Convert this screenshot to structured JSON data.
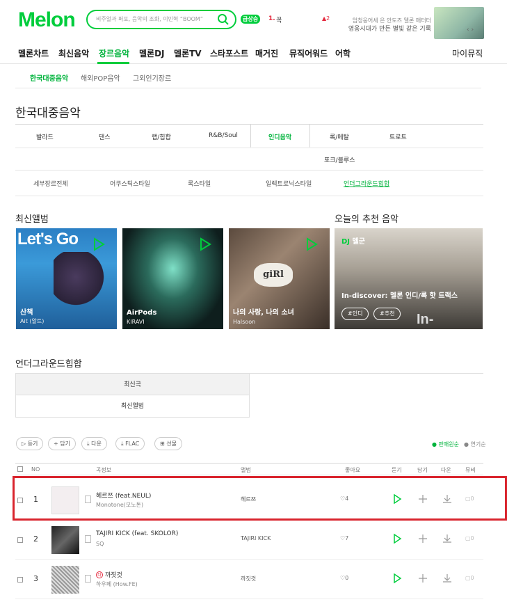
{
  "header": {
    "logo": "Melon",
    "search_placeholder": "비주얼과 퍼포, 음악의 조화, 이민혁 “BOOM”",
    "realtime_badge": "급상승",
    "realtime_rank": "1.",
    "realtime_title": "꼭",
    "realtime_change": "▲2",
    "promo_line1": "엄청웅어세 은 안도즈 멜론 매터터",
    "promo_line2": "영웅시대가 만든 별빛 같은 기록",
    "promo_nav": "‹ ›"
  },
  "nav": {
    "items": [
      "멜론차트",
      "최신음악",
      "장르음악",
      "멜론DJ",
      "멜론TV",
      "스타포스트",
      "매거진",
      "뮤직어워드",
      "어학"
    ],
    "my_music": "마이뮤직"
  },
  "subnav": {
    "items": [
      "한국대중음악",
      "해외POP음악",
      "그외인기장르"
    ]
  },
  "page_title": "한국대중음악",
  "genres": {
    "row1": [
      "발라드",
      "댄스",
      "랩/힙합",
      "R&B/Soul",
      "인디음악",
      "록/메탈",
      "트로트"
    ],
    "row2": [
      "포크/블루스"
    ],
    "sub": [
      "세부장르전체",
      "어쿠스틱스타일",
      "록스타일",
      "일렉트로닉스타일",
      "언더그라운드힙합"
    ]
  },
  "latest_albums": {
    "heading": "최신앨범",
    "items": [
      {
        "title": "산책",
        "artist": "Ait (알트)",
        "cover_text": "Let's Go"
      },
      {
        "title": "AirPods",
        "artist": "KIRAVI",
        "cover_text": ""
      },
      {
        "title": "나의 사랑, 나의 소녀",
        "artist": "Halsoon",
        "cover_text": "giRl"
      }
    ]
  },
  "recommend": {
    "heading": "오늘의 추천 음악",
    "dj_label": "DJ",
    "dj_name": "멜군",
    "title": "In-discover: 멜론 인디/록 핫 트랙스",
    "tags": [
      "#인디",
      "#추천"
    ],
    "cover_text": "In-discover"
  },
  "underground": {
    "heading": "언더그라운드힙합",
    "tabs": [
      "최신곡",
      "최신앨범"
    ]
  },
  "actions": {
    "buttons": [
      "▷ 듣기",
      "+ 담기",
      "⤓ 다운",
      "⤓ FLAC",
      "⊞ 선물"
    ],
    "sort_popular": "● 판매원순",
    "sort_recent": "● 연기순"
  },
  "table": {
    "headers": [
      "NO",
      "곡정보",
      "앨범",
      "좋아요",
      "듣기",
      "담기",
      "다운",
      "뮤비"
    ],
    "rows": [
      {
        "no": "1",
        "title": "헤르쯔 (feat.NEUL)",
        "artist": "Monotone(모노톤)",
        "album": "헤르쯔",
        "likes": "♡4",
        "mv": "▢0"
      },
      {
        "no": "2",
        "title": "TAJIRI KICK (feat. SKOLOR)",
        "artist": "SQ",
        "album": "TAJIRI KICK",
        "likes": "♡7",
        "mv": "▢0"
      },
      {
        "no": "3",
        "title": "까짓것",
        "artist": "하우페 (How.FE)",
        "album": "까짓것",
        "likes": "♡0",
        "mv": "▢0",
        "title_badge": "타"
      }
    ]
  },
  "colors": {
    "brand": "#00cd3c",
    "highlight": "#d9242d",
    "accent_red": "#e4273c"
  }
}
